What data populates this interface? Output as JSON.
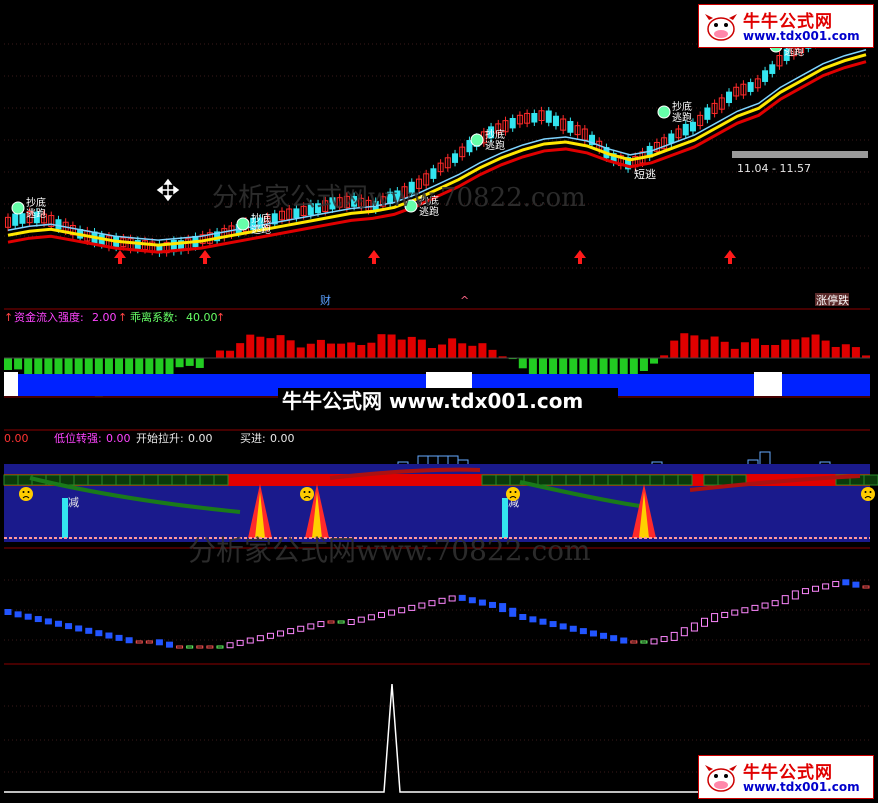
{
  "logos": {
    "title": "牛牛公式网",
    "url": "www.tdx001.com"
  },
  "watermarks": {
    "main": "牛牛公式网 www.tdx001.com",
    "secondary_1": "分析家公式网www.70822.com",
    "secondary_2": "分析家公式网www.70822.com"
  },
  "panel1": {
    "price_range_label": "11.04 - 11.57",
    "signal_labels": {
      "bottom": "抄底",
      "escape": "逃跑",
      "short_escape": "短逃",
      "wealth": "财",
      "limit_up": "涨停跌"
    }
  },
  "panel2": {
    "indicator1_name": "资金流入强度:",
    "indicator1_value": "2.00",
    "indicator2_name": "乖离系数:",
    "indicator2_value": "40.00"
  },
  "panel3": {
    "val0": "0.00",
    "ind1_name": "低位转强:",
    "ind1_value": "0.00",
    "ind2_name": "开始拉升:",
    "ind2_value": "0.00",
    "ind3_name": "买进:",
    "ind3_value": "0.00",
    "bar_label": "减"
  },
  "colors": {
    "up": "#ff2a2a",
    "down": "#33e5f0",
    "ma_yellow": "#ffe600",
    "ma_red": "#e00000",
    "ma_cyan": "#7fd4ff",
    "flow_green": "#22cc22",
    "flow_red": "#e00000",
    "flow_blue": "#0022ff",
    "panel_bg_blue": "#1a1a8c",
    "divider": "#8b0000"
  },
  "chart_data": {
    "type": "line",
    "title": "",
    "panels": [
      {
        "name": "price",
        "series": [
          {
            "values": [
              2.0,
              2.3,
              2.1,
              1.6,
              1.2,
              1.0,
              0.9,
              0.7,
              0.8,
              1.1,
              1.4,
              1.8,
              2.0,
              2.4,
              2.6,
              2.9,
              3.1,
              2.8,
              3.3,
              3.8,
              4.6,
              5.4,
              6.2,
              6.8,
              7.2,
              7.4,
              6.9,
              6.4,
              5.4,
              4.9,
              5.6,
              6.3,
              6.9,
              7.8,
              8.6,
              9.0,
              10.2,
              10.9,
              11.3,
              11.5,
              11.4
            ]
          },
          {
            "values": [
              1.2,
              1.4,
              1.5,
              1.3,
              1.1,
              0.9,
              0.8,
              0.7,
              0.8,
              0.9,
              1.1,
              1.3,
              1.5,
              1.7,
              1.9,
              2.1,
              2.3,
              2.4,
              2.6,
              3.0,
              3.5,
              4.0,
              4.6,
              5.1,
              5.5,
              5.8,
              5.9,
              5.7,
              5.3,
              5.0,
              5.2,
              5.6,
              6.0,
              6.6,
              7.2,
              7.6,
              8.4,
              9.0,
              9.6,
              10.0,
              10.3
            ]
          }
        ]
      },
      {
        "name": "flow",
        "series": [
          {
            "values": [
              -2,
              -3,
              -4,
              -5,
              -6,
              -5,
              -4,
              -3,
              -2,
              -1,
              1,
              3,
              4,
              3,
              2,
              3,
              2,
              3,
              4,
              3,
              2,
              3,
              2,
              1,
              -2,
              -3,
              -5,
              -6,
              -5,
              -3,
              -2,
              3,
              4,
              3,
              2,
              3,
              2,
              4,
              3,
              2,
              1
            ]
          }
        ]
      },
      {
        "name": "oscillator",
        "series": [
          {
            "values": [
              4,
              3,
              2,
              1,
              0,
              -1,
              -2,
              -2,
              -3,
              -3,
              -3,
              -2,
              -1,
              0,
              1,
              2,
              2,
              3,
              4,
              5,
              6,
              7,
              6,
              5,
              3,
              2,
              1,
              0,
              -1,
              -2,
              -2,
              -1,
              1,
              3,
              4,
              5,
              6,
              8,
              9,
              10,
              9
            ]
          }
        ]
      },
      {
        "name": "spike",
        "series": [
          {
            "values": [
              0,
              0,
              0,
              0,
              0,
              0,
              0,
              0,
              0,
              0,
              0,
              0,
              0,
              0,
              0,
              0,
              0,
              10,
              0,
              0,
              0,
              0,
              0,
              0,
              0,
              0,
              0,
              0,
              0,
              0,
              0,
              0,
              0,
              0,
              0,
              0,
              0,
              0,
              0,
              0,
              0
            ]
          }
        ]
      }
    ]
  }
}
